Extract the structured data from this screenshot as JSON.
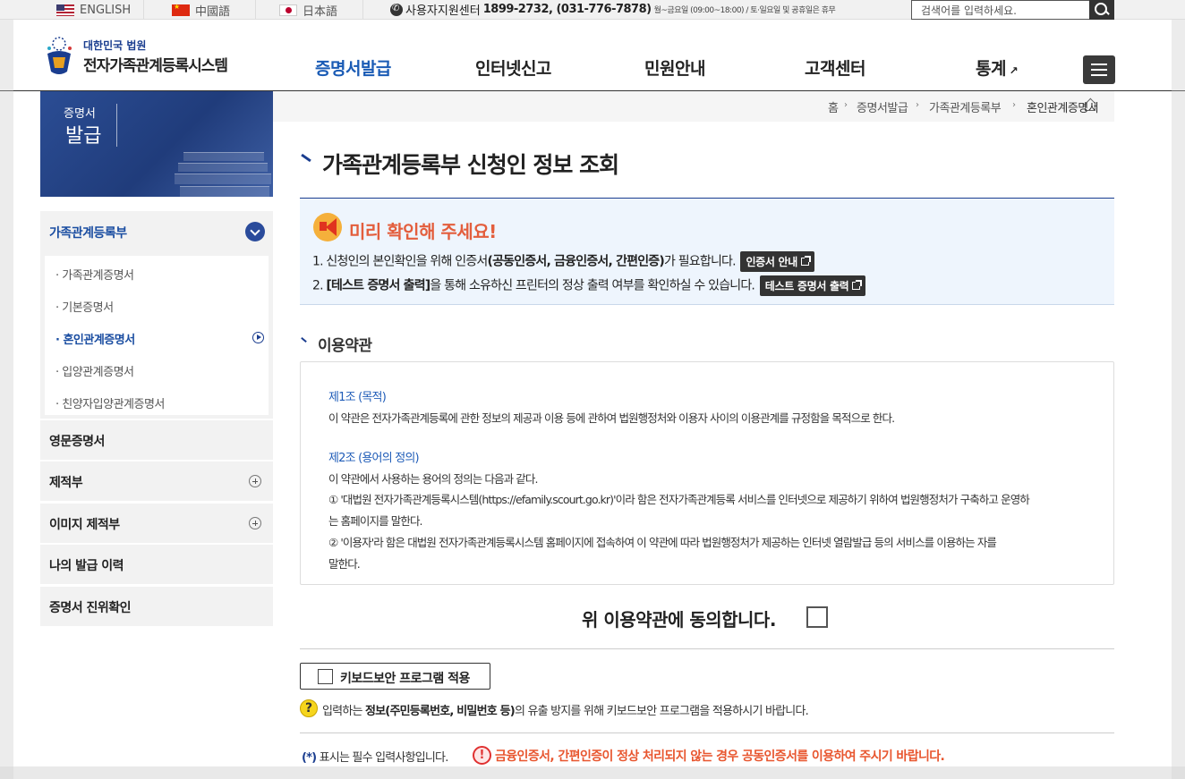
{
  "topbar": {
    "languages": [
      {
        "label": "ENGLISH",
        "flag": "us-flag-icon"
      },
      {
        "label": "中國語",
        "flag": "cn-flag-icon"
      },
      {
        "label": "日本語",
        "flag": "jp-flag-icon"
      }
    ],
    "support_label": "사용자지원센터",
    "support_phone": "1899-2732, (031-776-7878)",
    "support_hours": "월~금요일 (09:00~18:00) / 토·일요일 및 공휴일은 휴무",
    "search_placeholder": "검색어를 입력하세요."
  },
  "header": {
    "logo_top": "대한민국 법원",
    "logo_bottom": "전자가족관계등록시스템",
    "nav": [
      {
        "label": "증명서발급",
        "active": true
      },
      {
        "label": "인터넷신고"
      },
      {
        "label": "민원안내"
      },
      {
        "label": "고객센터"
      },
      {
        "label": "통계",
        "external": true
      }
    ]
  },
  "sidebar": {
    "banner_small": "증명서",
    "banner_big": "발급",
    "section": "가족관계등록부",
    "subitems": [
      {
        "label": "· 가족관계증명서"
      },
      {
        "label": "· 기본증명서"
      },
      {
        "label": "· 혼인관계증명서",
        "active": true
      },
      {
        "label": "· 입양관계증명서"
      },
      {
        "label": "· 친양자입양관계증명서"
      }
    ],
    "items": [
      {
        "label": "영문증명서",
        "expandable": false
      },
      {
        "label": "제적부",
        "expandable": true
      },
      {
        "label": "이미지 제적부",
        "expandable": true
      },
      {
        "label": "나의 발급 이력",
        "expandable": false
      },
      {
        "label": "증명서 진위확인",
        "expandable": false
      }
    ]
  },
  "breadcrumb": [
    "홈",
    "증명서발급",
    "가족관계등록부",
    "혼인관계증명서"
  ],
  "main": {
    "title": "가족관계등록부 신청인 정보 조회",
    "notice": {
      "title": "미리 확인해 주세요!",
      "line1_pre": "1. 신청인의 본인확인을 위해 인증서",
      "line1_bold": "(공동인증서, 금융인증서, 간편인증)",
      "line1_post": "가 필요합니다.",
      "line1_button": "인증서 안내",
      "line2_pre": "2. ",
      "line2_bold": "[테스트 증명서 출력]",
      "line2_post": "을 통해 소유하신 프린터의 정상 출력 여부를 확인하실 수 있습니다.",
      "line2_button": "테스트 증명서 출력"
    },
    "terms_title": "이용약관",
    "terms": {
      "art1_head": "제1조 (목적)",
      "art1_body": "이 약관은 전자가족관계등록에 관한 정보의 제공과 이용 등에 관하여 법원행정처와 이용자 사이의 이용관계를 규정함을 목적으로 한다.",
      "art2_head": "제2조 (용어의 정의)",
      "art2_body": "이 약관에서 사용하는 용어의 정의는 다음과 같다.",
      "art2_item1_a": "① '대법원 전자가족관계등록시스템(https://efamily.scourt.go.kr)'이라 함은 전자가족관계등록 서비스를 인터넷으로 제공하기 위하여 법원행정처가 구축하고 운영하",
      "art2_item1_b": "는 홈페이지를 말한다.",
      "art2_item2_a": "② '이용자'라 함은 대법원 전자가족관계등록시스템 홈페이지에 접속하여 이 약관에 따라 법원행정처가 제공하는 인터넷 열람발급 등의 서비스를 이용하는 자를",
      "art2_item2_b": "말한다."
    },
    "agree_label": "위 이용약관에 동의합니다.",
    "keyboard_button": "키보드보안 프로그램 적용",
    "keyboard_info_pre": "입력하는 ",
    "keyboard_info_bold": "정보(주민등록번호, 비밀번호 등)",
    "keyboard_info_post": "의 유출 방지를 위해 키보드보안 프로그램을 적용하시기 바랍니다.",
    "required_note": "표시는 필수 입력사항입니다.",
    "required_star": "(*)",
    "warning": "금융인증서, 간편인증이 정상 처리되지 않는 경우 공동인증서를 이용하여 주시기 바랍니다."
  }
}
